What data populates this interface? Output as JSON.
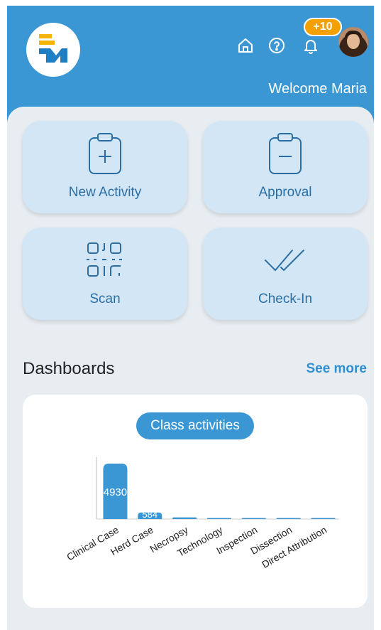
{
  "header": {
    "welcome": "Welcome Maria",
    "notifications_badge": "+10",
    "icons": [
      "logo",
      "home-icon",
      "help-icon",
      "bell-icon",
      "avatar"
    ]
  },
  "actions": [
    {
      "label": "New Activity",
      "icon": "clipboard-plus-icon"
    },
    {
      "label": "Approval",
      "icon": "clipboard-minus-icon"
    },
    {
      "label": "Scan",
      "icon": "qr-scan-icon"
    },
    {
      "label": "Check-In",
      "icon": "double-check-icon"
    }
  ],
  "dashboards": {
    "title": "Dashboards",
    "see_more": "See more"
  },
  "chart_data": {
    "type": "bar",
    "title": "Class activities",
    "categories": [
      "Clinical Case",
      "Herd Case",
      "Necropsy",
      "Technology",
      "Inspection",
      "Dissection",
      "Direct Attribution"
    ],
    "values": [
      4930,
      584,
      150,
      90,
      60,
      25,
      10
    ],
    "data_labels": [
      "4930",
      "584",
      "",
      "",
      "",
      "",
      ""
    ],
    "ylim": [
      0,
      5500
    ],
    "grid": false,
    "colors": {
      "bar": "#3a97d4",
      "label": "#ffffff"
    }
  },
  "colors": {
    "primary": "#3a97d4",
    "tile": "#d2e6f5",
    "badge": "#f4a000",
    "panel": "#e8edf2"
  }
}
